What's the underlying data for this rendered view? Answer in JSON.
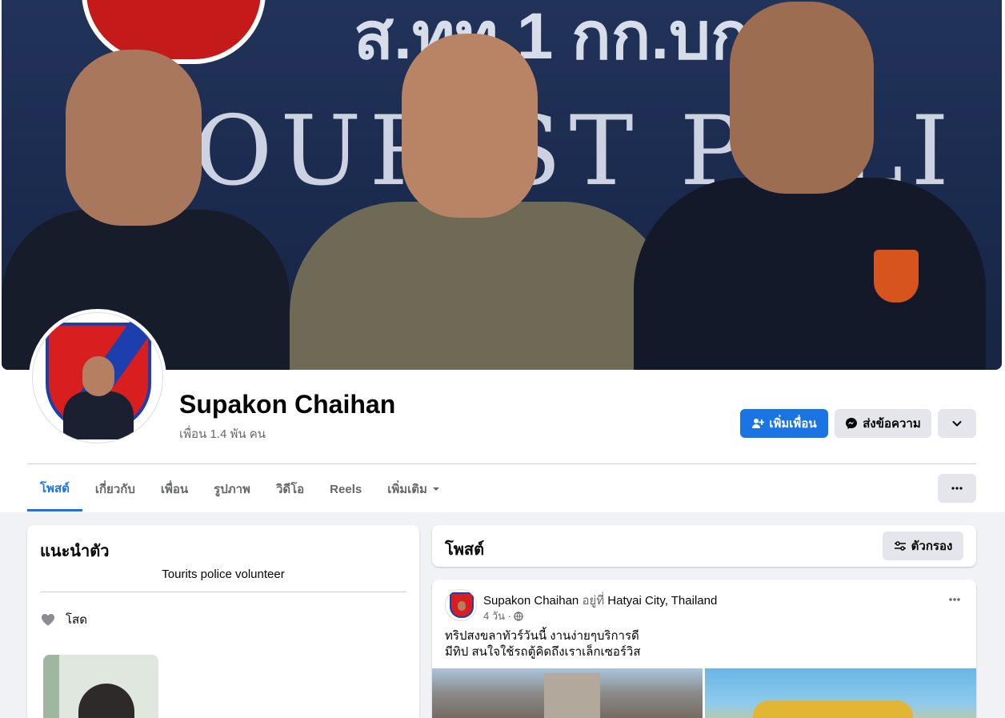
{
  "profile": {
    "name": "Supakon Chaihan",
    "friends_count": "เพื่อน 1.4 พัน คน"
  },
  "actions": {
    "add_friend": "เพิ่มเพื่อน",
    "message": "ส่งข้อความ"
  },
  "tabs": [
    {
      "label": "โพสต์",
      "active": true
    },
    {
      "label": "เกี่ยวกับ"
    },
    {
      "label": "เพื่อน"
    },
    {
      "label": "รูปภาพ"
    },
    {
      "label": "วิดีโอ"
    },
    {
      "label": "Reels"
    },
    {
      "label": "เพิ่มเติม"
    }
  ],
  "intro": {
    "title": "แนะนำตัว",
    "bio": "Tourits police volunteer",
    "relationship": "โสด"
  },
  "posts_section": {
    "title": "โพสต์",
    "filter_label": "ตัวกรอง"
  },
  "post": {
    "author": "Supakon Chaihan",
    "at_word": "อยู่ที่",
    "place": "Hatyai City, Thailand",
    "time": "4 วัน ·",
    "text_line1": "ทริปสงขลาทัวร์วันนี้ งานง่ายๆบริการดี",
    "text_line2": "มีทิป สนใจใช้รถตู้คิดถึงเราเล็กเซอร์วิส"
  },
  "colors": {
    "accent": "#1b74e4",
    "secondary_button": "#e4e6eb",
    "page_background": "#f0f2f5"
  },
  "icons": {
    "add_friend": "person-plus-icon",
    "message": "messenger-icon",
    "chevron": "chevron-down-icon",
    "more": "more-horizontal-icon",
    "filter": "filter-icon",
    "heart": "heart-icon",
    "privacy": "globe-icon"
  }
}
